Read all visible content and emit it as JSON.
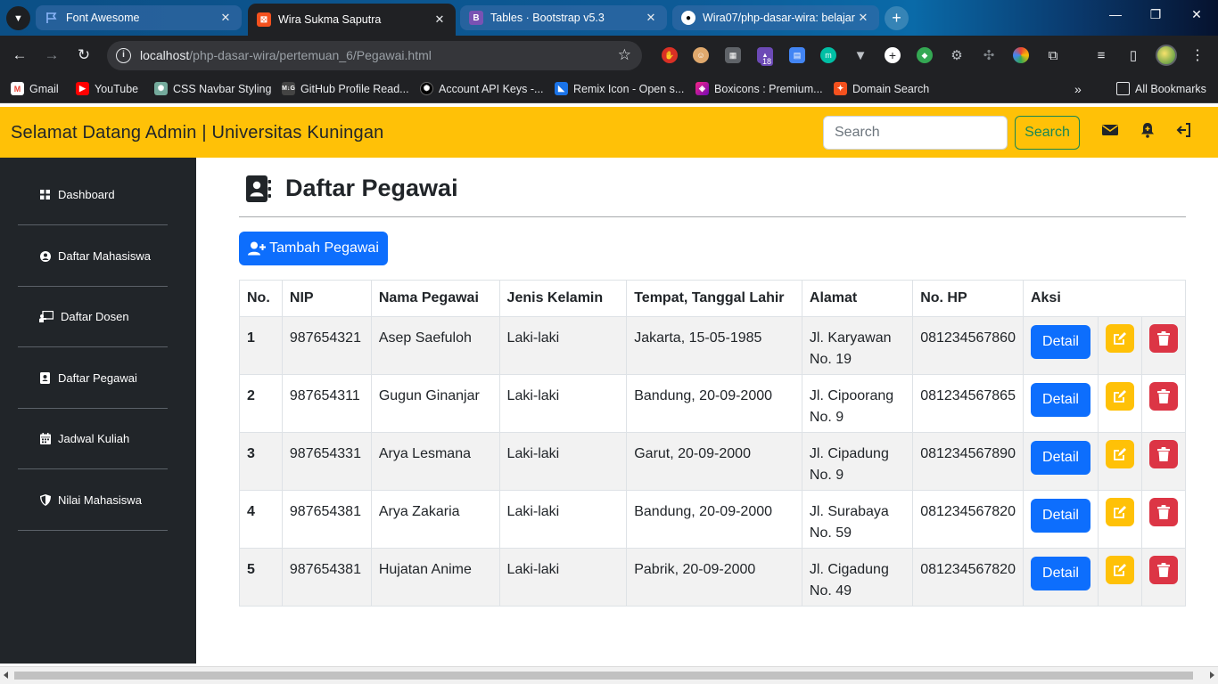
{
  "browser": {
    "tabs": [
      {
        "title": "Font Awesome",
        "active": false
      },
      {
        "title": "Wira Sukma Saputra",
        "active": true
      },
      {
        "title": "Tables · Bootstrap v5.3",
        "active": false
      },
      {
        "title": "Wira07/php-dasar-wira: belajar",
        "active": false
      }
    ],
    "url_host": "localhost",
    "url_path": "/php-dasar-wira/pertemuan_6/Pegawai.html",
    "extension_badge": "18",
    "bookmarks": [
      {
        "label": "Gmail",
        "icon": "gmail-icon"
      },
      {
        "label": "YouTube",
        "icon": "youtube-icon"
      },
      {
        "label": "CSS Navbar Styling",
        "icon": "openai-icon"
      },
      {
        "label": "GitHub Profile Read...",
        "icon": "github-readme-icon"
      },
      {
        "label": "Account API Keys -...",
        "icon": "openai-icon"
      },
      {
        "label": "Remix Icon - Open s...",
        "icon": "remix-icon"
      },
      {
        "label": "Boxicons : Premium...",
        "icon": "boxicons-icon"
      },
      {
        "label": "Domain Search",
        "icon": "domain-icon"
      }
    ],
    "all_bookmarks": "All Bookmarks"
  },
  "header": {
    "brand": "Selamat Datang Admin | Universitas Kuningan",
    "search_placeholder": "Search",
    "search_button": "Search"
  },
  "sidebar": {
    "items": [
      {
        "label": "Dashboard",
        "icon": "grid-icon"
      },
      {
        "label": "Daftar Mahasiswa",
        "icon": "user-circle-icon"
      },
      {
        "label": "Daftar Dosen",
        "icon": "chalkboard-teacher-icon"
      },
      {
        "label": "Daftar Pegawai",
        "icon": "address-book-icon"
      },
      {
        "label": "Jadwal Kuliah",
        "icon": "calendar-icon"
      },
      {
        "label": "Nilai Mahasiswa",
        "icon": "shield-icon"
      }
    ]
  },
  "main": {
    "title": "Daftar Pegawai",
    "add_button": "Tambah Pegawai",
    "table": {
      "columns": [
        "No.",
        "NIP",
        "Nama Pegawai",
        "Jenis Kelamin",
        "Tempat, Tanggal Lahir",
        "Alamat",
        "No. HP",
        "Aksi"
      ],
      "detail_label": "Detail",
      "rows": [
        {
          "no": "1",
          "nip": "987654321",
          "nama": "Asep Saefuloh",
          "jk": "Laki-laki",
          "ttl": "Jakarta, 15-05-1985",
          "alamat": "Jl. Karyawan No. 19",
          "hp": "081234567860"
        },
        {
          "no": "2",
          "nip": "987654311",
          "nama": "Gugun Ginanjar",
          "jk": "Laki-laki",
          "ttl": "Bandung, 20-09-2000",
          "alamat": "Jl. Cipoorang No. 9",
          "hp": "081234567865"
        },
        {
          "no": "3",
          "nip": "987654331",
          "nama": "Arya Lesmana",
          "jk": "Laki-laki",
          "ttl": "Garut, 20-09-2000",
          "alamat": "Jl. Cipadung No. 9",
          "hp": "081234567890"
        },
        {
          "no": "4",
          "nip": "987654381",
          "nama": "Arya Zakaria",
          "jk": "Laki-laki",
          "ttl": "Bandung, 20-09-2000",
          "alamat": "Jl. Surabaya No. 59",
          "hp": "081234567820"
        },
        {
          "no": "5",
          "nip": "987654381",
          "nama": "Hujatan Anime",
          "jk": "Laki-laki",
          "ttl": "Pabrik, 20-09-2000",
          "alamat": "Jl. Cigadung No. 49",
          "hp": "081234567820"
        }
      ]
    }
  },
  "colors": {
    "topbar": "#ffc107",
    "sidebar": "#212529",
    "primary": "#0d6efd",
    "success": "#198754",
    "warning": "#ffc107",
    "danger": "#dc3545"
  }
}
